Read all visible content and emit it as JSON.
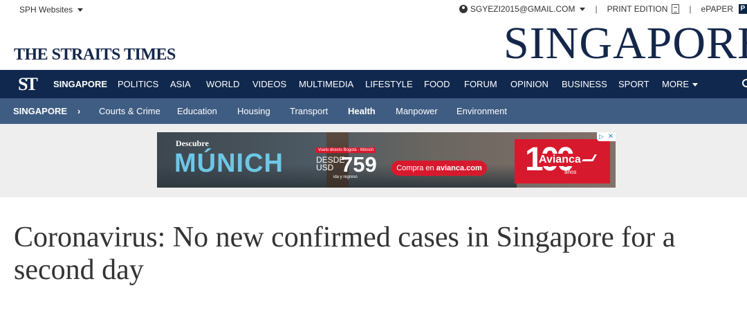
{
  "util": {
    "sph_label": "SPH Websites",
    "account_email": "SGYEZI2015@GMAIL.COM",
    "print_edition": "PRINT EDITION",
    "separator": "|",
    "epaper": "ePAPER",
    "epaper_icon_letter": "P"
  },
  "masthead": {
    "logo": "THE STRAITS TIMES",
    "section_title": "SINGAPORE"
  },
  "mainnav": {
    "logo": "ST",
    "items": [
      "SINGAPORE",
      "POLITICS",
      "ASIA",
      "WORLD",
      "VIDEOS",
      "MULTIMEDIA",
      "LIFESTYLE",
      "FOOD",
      "FORUM",
      "OPINION",
      "BUSINESS",
      "SPORT",
      "MORE"
    ],
    "active": "SINGAPORE"
  },
  "subnav": {
    "section": "SINGAPORE",
    "arrow": "›",
    "items": [
      "Courts & Crime",
      "Education",
      "Housing",
      "Transport",
      "Health",
      "Manpower",
      "Environment"
    ],
    "active": "Health"
  },
  "ad": {
    "descubre": "Descubre",
    "city": "MÚNICH",
    "route": "Vuelo directo Bogotá - Múnich",
    "desde": "DESDE",
    "currency": "USD",
    "price": "759",
    "trip": "ida y regreso",
    "cta_prefix": "Compra en ",
    "cta_site": "avianca.com",
    "anniversary": "100",
    "brand": "Avianca",
    "anos": "años",
    "adchoices": "▷",
    "close": "✕"
  },
  "article": {
    "headline": "Coronavirus: No new confirmed cases in Singapore for a second day"
  },
  "colors": {
    "nav": "#10284d",
    "subnav": "#3f5d82",
    "masthead": "#14274a",
    "ad_red": "#d7192d"
  }
}
